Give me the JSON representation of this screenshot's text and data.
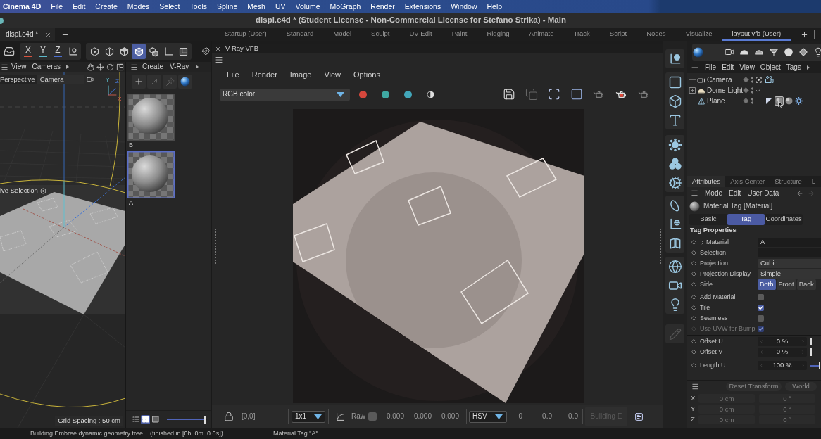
{
  "menu_bar": {
    "app_name": "Cinema 4D",
    "items": [
      "File",
      "Edit",
      "Create",
      "Modes",
      "Select",
      "Tools",
      "Spline",
      "Mesh",
      "UV",
      "Volume",
      "MoGraph",
      "Render",
      "Extensions",
      "Window",
      "Help"
    ]
  },
  "title_bar": {
    "title": "displ.c4d * (Student License - Non-Commercial License for Stefano Strika) - Main"
  },
  "document_tabs": [
    {
      "label": "displ.c4d *",
      "selected": true
    }
  ],
  "layouts": [
    {
      "label": "Startup (User)",
      "selected": false
    },
    {
      "label": "Standard",
      "selected": false
    },
    {
      "label": "Model",
      "selected": false
    },
    {
      "label": "Sculpt",
      "selected": false
    },
    {
      "label": "UV Edit",
      "selected": false
    },
    {
      "label": "Paint",
      "selected": false
    },
    {
      "label": "Rigging",
      "selected": false
    },
    {
      "label": "Animate",
      "selected": false
    },
    {
      "label": "Track",
      "selected": false
    },
    {
      "label": "Script",
      "selected": false
    },
    {
      "label": "Nodes",
      "selected": false
    },
    {
      "label": "Visualize",
      "selected": false
    },
    {
      "label": "layout vfb (User)",
      "selected": true
    }
  ],
  "toolbar": {
    "axes": [
      {
        "label": "X",
        "color": "#d9533f"
      },
      {
        "label": "Y",
        "color": "#5cb8c9"
      },
      {
        "label": "Z",
        "color": "#4b6fd1"
      }
    ],
    "modes": [
      {
        "kind": "points",
        "selected": false
      },
      {
        "kind": "edges",
        "selected": false
      },
      {
        "kind": "polygons",
        "selected": false
      },
      {
        "kind": "model",
        "selected": true
      },
      {
        "kind": "texture",
        "selected": false
      },
      {
        "kind": "axis",
        "selected": false
      },
      {
        "kind": "solo",
        "selected": false
      }
    ]
  },
  "viewport": {
    "menu": [
      "View",
      "Cameras"
    ],
    "projection": "Perspective",
    "camera": "Camera",
    "gizmo_labels": [
      "Y",
      "Z",
      "X"
    ],
    "active_tool": "ive Selection",
    "grid_spacing": "Grid Spacing : 50 cm"
  },
  "material_manager": {
    "menu": [
      "Create",
      "V-Ray"
    ],
    "materials": [
      {
        "name": "B",
        "selected": false
      },
      {
        "name": "A",
        "selected": true
      }
    ],
    "view_modes": [
      {
        "kind": "list",
        "selected": false
      },
      {
        "kind": "grid",
        "selected": true
      },
      {
        "kind": "single",
        "selected": false
      }
    ],
    "thumbnail_size": {
      "level": 0.97
    }
  },
  "vfb": {
    "title": "V-Ray VFB",
    "menu": [
      "File",
      "Render",
      "Image",
      "View",
      "Options"
    ],
    "channel": "RGB color",
    "channel_toggles": [
      {
        "color": "#d5473c"
      },
      {
        "color": "#3fa8a2"
      },
      {
        "color": "#42a6b9"
      }
    ],
    "pixel": "[0,0]",
    "zoom": "1x1",
    "raw_label": "Raw",
    "raw_checked": false,
    "rgb_values": [
      "0.000",
      "0.000",
      "0.000"
    ],
    "color_space": "HSV",
    "hsv_values": [
      "0",
      "0.0",
      "0.0"
    ],
    "render_button": {
      "label": "Building E",
      "disabled": true
    }
  },
  "object_manager": {
    "menu": [
      "File",
      "Edit",
      "View",
      "Object",
      "Tags"
    ],
    "objects": [
      {
        "name": "Camera",
        "kind": "camera",
        "tags": [
          {
            "kind": "camera-tag",
            "selected": false
          }
        ]
      },
      {
        "name": "Dome Light",
        "kind": "dome-light",
        "expanded": false,
        "enabled": true
      },
      {
        "name": "Plane",
        "kind": "plane",
        "tags": [
          {
            "kind": "phong",
            "selected": false
          },
          {
            "kind": "material",
            "selected": true
          },
          {
            "kind": "material",
            "selected": false
          },
          {
            "kind": "render-tag",
            "selected": false
          }
        ]
      }
    ]
  },
  "attributes": {
    "tabs": [
      {
        "label": "Attributes",
        "selected": true
      },
      {
        "label": "Axis Center",
        "selected": false
      },
      {
        "label": "Structure",
        "selected": false
      },
      {
        "label": "L",
        "selected": false
      }
    ],
    "menu": [
      "Mode",
      "Edit",
      "User Data"
    ],
    "title": "Material Tag [Material]",
    "sections": [
      {
        "label": "Basic",
        "selected": false
      },
      {
        "label": "Tag",
        "selected": true
      },
      {
        "label": "Coordinates",
        "selected": false
      }
    ],
    "heading": "Tag Properties",
    "groups": [
      {
        "ruled": false,
        "properties": [
          {
            "kind": "link",
            "label": "Material",
            "value": "A",
            "expanded": false
          },
          {
            "kind": "link",
            "label": "Selection"
          },
          {
            "kind": "dropdown",
            "label": "Projection",
            "value": "Cubic"
          },
          {
            "kind": "dropdown",
            "label": "Projection Display",
            "value": "Simple"
          },
          {
            "kind": "segmented",
            "label": "Side",
            "options": [
              {
                "label": "Both",
                "selected": true
              },
              {
                "label": "Front",
                "selected": false
              },
              {
                "label": "Back",
                "selected": false
              }
            ]
          }
        ]
      },
      {
        "ruled": true,
        "properties": [
          {
            "kind": "checkbox",
            "label": "Add Material",
            "checked": false,
            "disabled": false
          },
          {
            "kind": "checkbox",
            "label": "Tile",
            "checked": true,
            "disabled": false
          },
          {
            "kind": "checkbox",
            "label": "Seamless",
            "checked": false,
            "disabled": false
          },
          {
            "kind": "checkbox",
            "label": "Use UVW for Bump",
            "checked": true,
            "disabled": true
          }
        ]
      },
      {
        "ruled": true,
        "properties": [
          {
            "kind": "number",
            "label": "Offset U",
            "value": "0 %",
            "level": 0
          },
          {
            "kind": "number",
            "label": "Offset V",
            "value": "0 %",
            "level": 0
          }
        ]
      },
      {
        "ruled": false,
        "properties": [
          {
            "kind": "number",
            "label": "Length U",
            "value": "100 %",
            "level": 1
          }
        ]
      }
    ]
  },
  "coordinates": {
    "buttons": [
      "Reset Transform",
      "World"
    ],
    "rows": [
      {
        "axis": "X",
        "position": "0 cm",
        "rotation": "0 °"
      },
      {
        "axis": "Y",
        "position": "0 cm",
        "rotation": "0 °"
      },
      {
        "axis": "Z",
        "position": "0 cm",
        "rotation": "0 °"
      }
    ]
  },
  "status_bar": {
    "message": "Building Embree dynamic geometry tree... (finished in [0h  0m  0.0s])",
    "selection": "Material Tag \"A\""
  }
}
